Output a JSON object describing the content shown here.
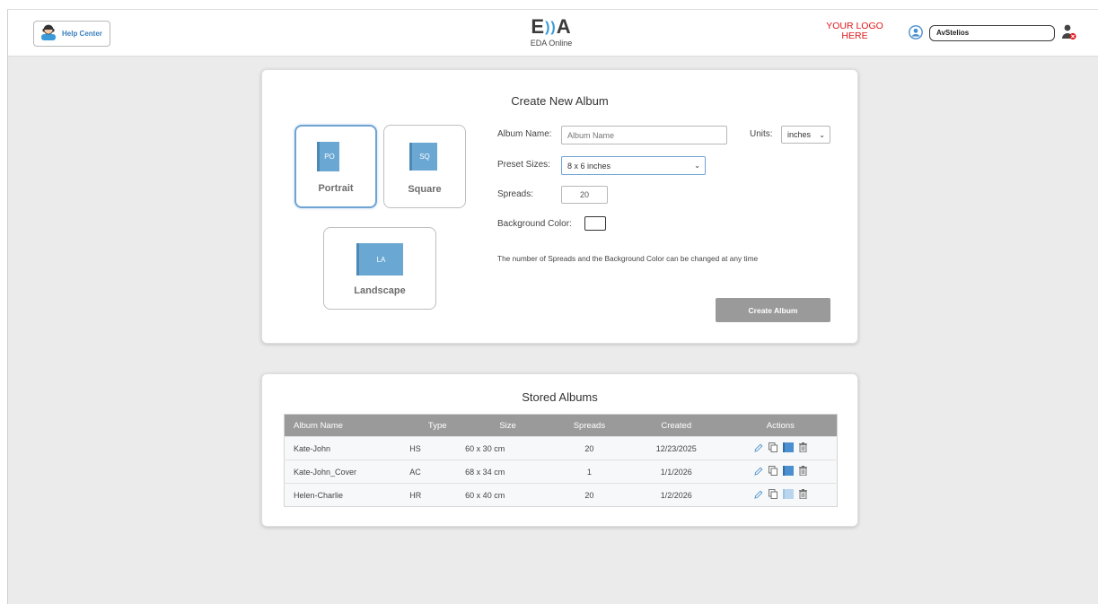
{
  "header": {
    "help_label": "Help Center",
    "brand_mark_left": "E",
    "brand_mark_right": "A",
    "brand_name": "EDA Online",
    "logo_placeholder_line1": "YOUR LOGO",
    "logo_placeholder_line2": "HERE",
    "username": "AvStelios"
  },
  "create": {
    "title": "Create New Album",
    "types": [
      {
        "code": "PO",
        "label": "Portrait",
        "selected": true
      },
      {
        "code": "SQ",
        "label": "Square",
        "selected": false
      },
      {
        "code": "LA",
        "label": "Landscape",
        "selected": false
      }
    ],
    "album_name_label": "Album Name:",
    "album_name_placeholder": "Album Name",
    "units_label": "Units:",
    "units_value": "inches",
    "preset_label": "Preset Sizes:",
    "preset_value": "8 x 6  inches",
    "spreads_label": "Spreads:",
    "spreads_value": "20",
    "bg_color_label": "Background Color:",
    "bg_color_value": "#ffffff",
    "note": "The number of Spreads and the Background Color can be changed at any time",
    "button": "Create Album"
  },
  "stored": {
    "title": "Stored Albums",
    "columns": [
      "Album Name",
      "Type",
      "Size",
      "Spreads",
      "Created",
      "Actions"
    ],
    "rows": [
      {
        "name": "Kate-John",
        "type": "HS",
        "size": "60 x 30 cm",
        "spreads": "20",
        "created": "12/23/2025",
        "book_active": true
      },
      {
        "name": "Kate-John_Cover",
        "type": "AC",
        "size": "68 x 34 cm",
        "spreads": "1",
        "created": "1/1/2026",
        "book_active": true
      },
      {
        "name": "Helen-Charlie",
        "type": "HR",
        "size": "60 x 40 cm",
        "spreads": "20",
        "created": "1/2/2026",
        "book_active": false
      }
    ]
  },
  "colors": {
    "accent": "#3a9ad9",
    "book": "#6aa7d3",
    "table_header": "#9a9a9a",
    "logo_red": "#e0171b"
  }
}
